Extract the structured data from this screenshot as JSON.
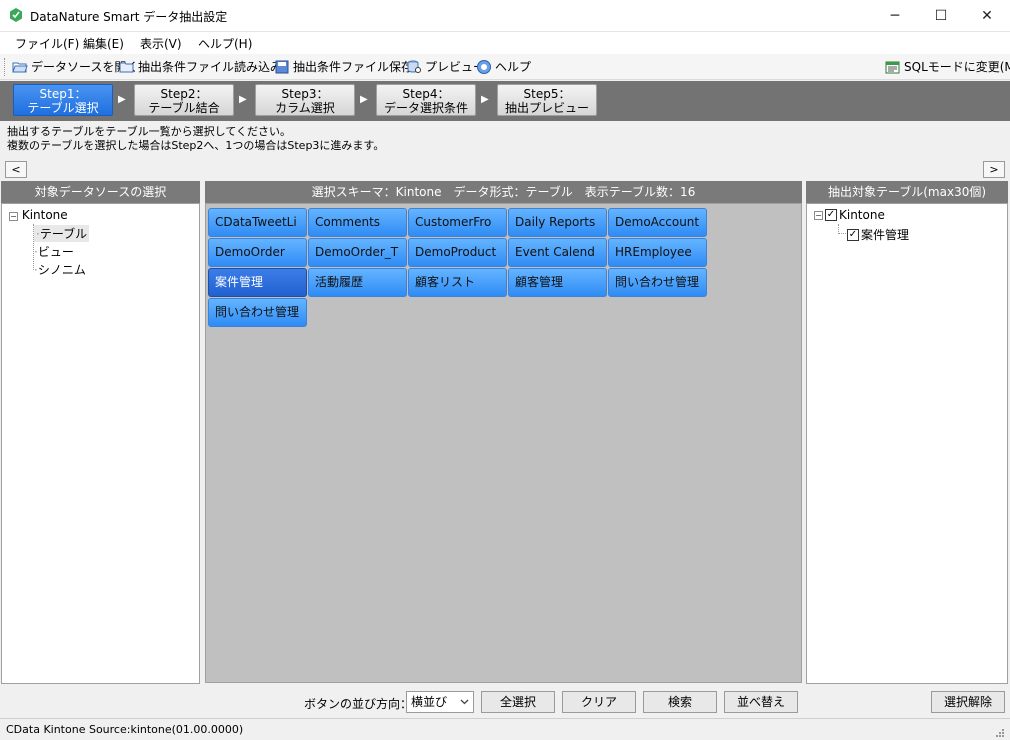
{
  "window": {
    "title": "DataNature Smart データ抽出設定",
    "minimize": "─",
    "maximize": "☐",
    "close": "✕"
  },
  "menu": [
    "ファイル(F)",
    "編集(E)",
    "表示(V)",
    "ヘルプ(H)"
  ],
  "toolbar": {
    "open_datasource": "データソースを開く",
    "load_condition": "抽出条件ファイル読み込み",
    "save_condition": "抽出条件ファイル保存",
    "preview": "プレビュー",
    "help": "ヘルプ",
    "sql_mode": "SQLモードに変更(M)"
  },
  "steps": [
    {
      "line1": "Step1：",
      "line2": "テーブル選択",
      "active": true
    },
    {
      "line1": "Step2：",
      "line2": "テーブル結合",
      "active": false
    },
    {
      "line1": "Step3：",
      "line2": "カラム選択",
      "active": false
    },
    {
      "line1": "Step4：",
      "line2": "データ選択条件",
      "active": false
    },
    {
      "line1": "Step5：",
      "line2": "抽出プレビュー",
      "active": false
    }
  ],
  "step_arrow": "▶",
  "instructions": {
    "line1": "抽出するテーブルをテーブル一覧から選択してください。",
    "line2": "複数のテーブルを選択した場合はStep2へ、1つの場合はStep3に進みます。",
    "prev": "<",
    "next": ">"
  },
  "left_panel": {
    "header": "対象データソースの選択",
    "root": "Kintone",
    "children": [
      "テーブル",
      "ビュー",
      "シノニム"
    ]
  },
  "center_panel": {
    "header": "選択スキーマ：Kintone　データ形式：テーブル　表示テーブル数：16",
    "tables": [
      "CDataTweetLi",
      "Comments",
      "CustomerFro",
      "Daily Reports",
      "DemoAccount",
      "DemoOrder",
      "DemoOrder_T",
      "DemoProduct",
      "Event Calend",
      "HREmployee",
      "案件管理",
      "活動履歴",
      "顧客リスト",
      "顧客管理",
      "問い合わせ管理",
      "問い合わせ管理"
    ],
    "selected_index": 10
  },
  "right_panel": {
    "header": "抽出対象テーブル(max30個)",
    "root": "Kintone",
    "children": [
      "案件管理"
    ]
  },
  "bottom": {
    "orientation_label": "ボタンの並び方向：",
    "orientation_value": "横並び",
    "select_all": "全選択",
    "clear": "クリア",
    "search": "検索",
    "sort": "並べ替え",
    "deselect": "選択解除"
  },
  "status": "CData Kintone Source:kintone(01.00.0000)",
  "colors": {
    "table_button": "#3f97f8",
    "table_button_selected": "#2a68d8",
    "step_active": "#2a7be6",
    "panel_header": "#7a7a7a"
  }
}
